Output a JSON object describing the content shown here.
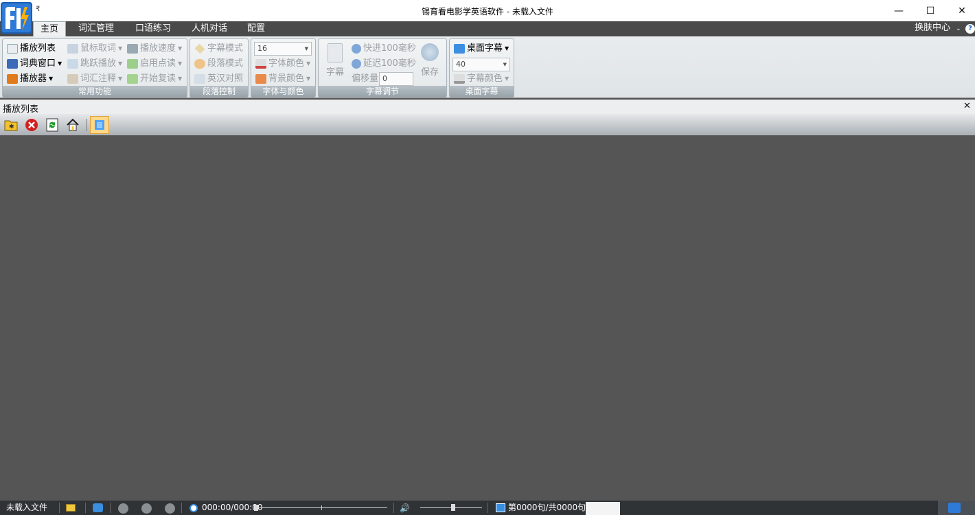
{
  "window": {
    "title": "锡育看电影学英语软件 - 未载入文件",
    "qat_symbol": "₹",
    "minimize": "—",
    "maximize": "☐",
    "close": "✕"
  },
  "menu": {
    "tabs": [
      "主页",
      "词汇管理",
      "口语练习",
      "人机对话",
      "配置"
    ],
    "active": "主页",
    "skin_center": "换肤中心",
    "skin_arrow": "⌄",
    "help": "?"
  },
  "ribbon": {
    "common": {
      "caption": "常用功能",
      "playlist": "播放列表",
      "dictionary": "词典窗口",
      "player": "播放器",
      "mouse_word": "鼠标取词",
      "skip_play": "跳跃播放",
      "vocab_note": "词汇注释",
      "play_speed": "播放速度",
      "enable_dictation": "启用点读",
      "start_repeat": "开始复读"
    },
    "paragraph": {
      "caption": "段落控制",
      "subtitle_mode": "字幕模式",
      "paragraph_mode": "段落模式",
      "bilingual": "英汉对照"
    },
    "font": {
      "caption": "字体与颜色",
      "size": "16",
      "font_color": "字体颜色",
      "bg_color": "背景颜色"
    },
    "subtitle_adjust": {
      "caption": "字幕调节",
      "subtitle": "字幕",
      "fast_forward": "快进100毫秒",
      "delay": "延迟100毫秒",
      "offset_label": "偏移量",
      "offset_value": "0",
      "save": "保存"
    },
    "desktop_subtitle": {
      "caption": "桌面字幕",
      "toggle": "桌面字幕",
      "size": "40",
      "color": "字幕颜色"
    }
  },
  "playlist_panel": {
    "title": "播放列表",
    "close": "✕"
  },
  "status": {
    "file": "未载入文件",
    "time": "000:00/000:00",
    "sentence": "第0000句/共0000句"
  },
  "colors": {
    "accent": "#1565c0",
    "ribbon_caption": "#9aa5ac",
    "workspace": "#555555",
    "statusbar": "#2f3336"
  }
}
